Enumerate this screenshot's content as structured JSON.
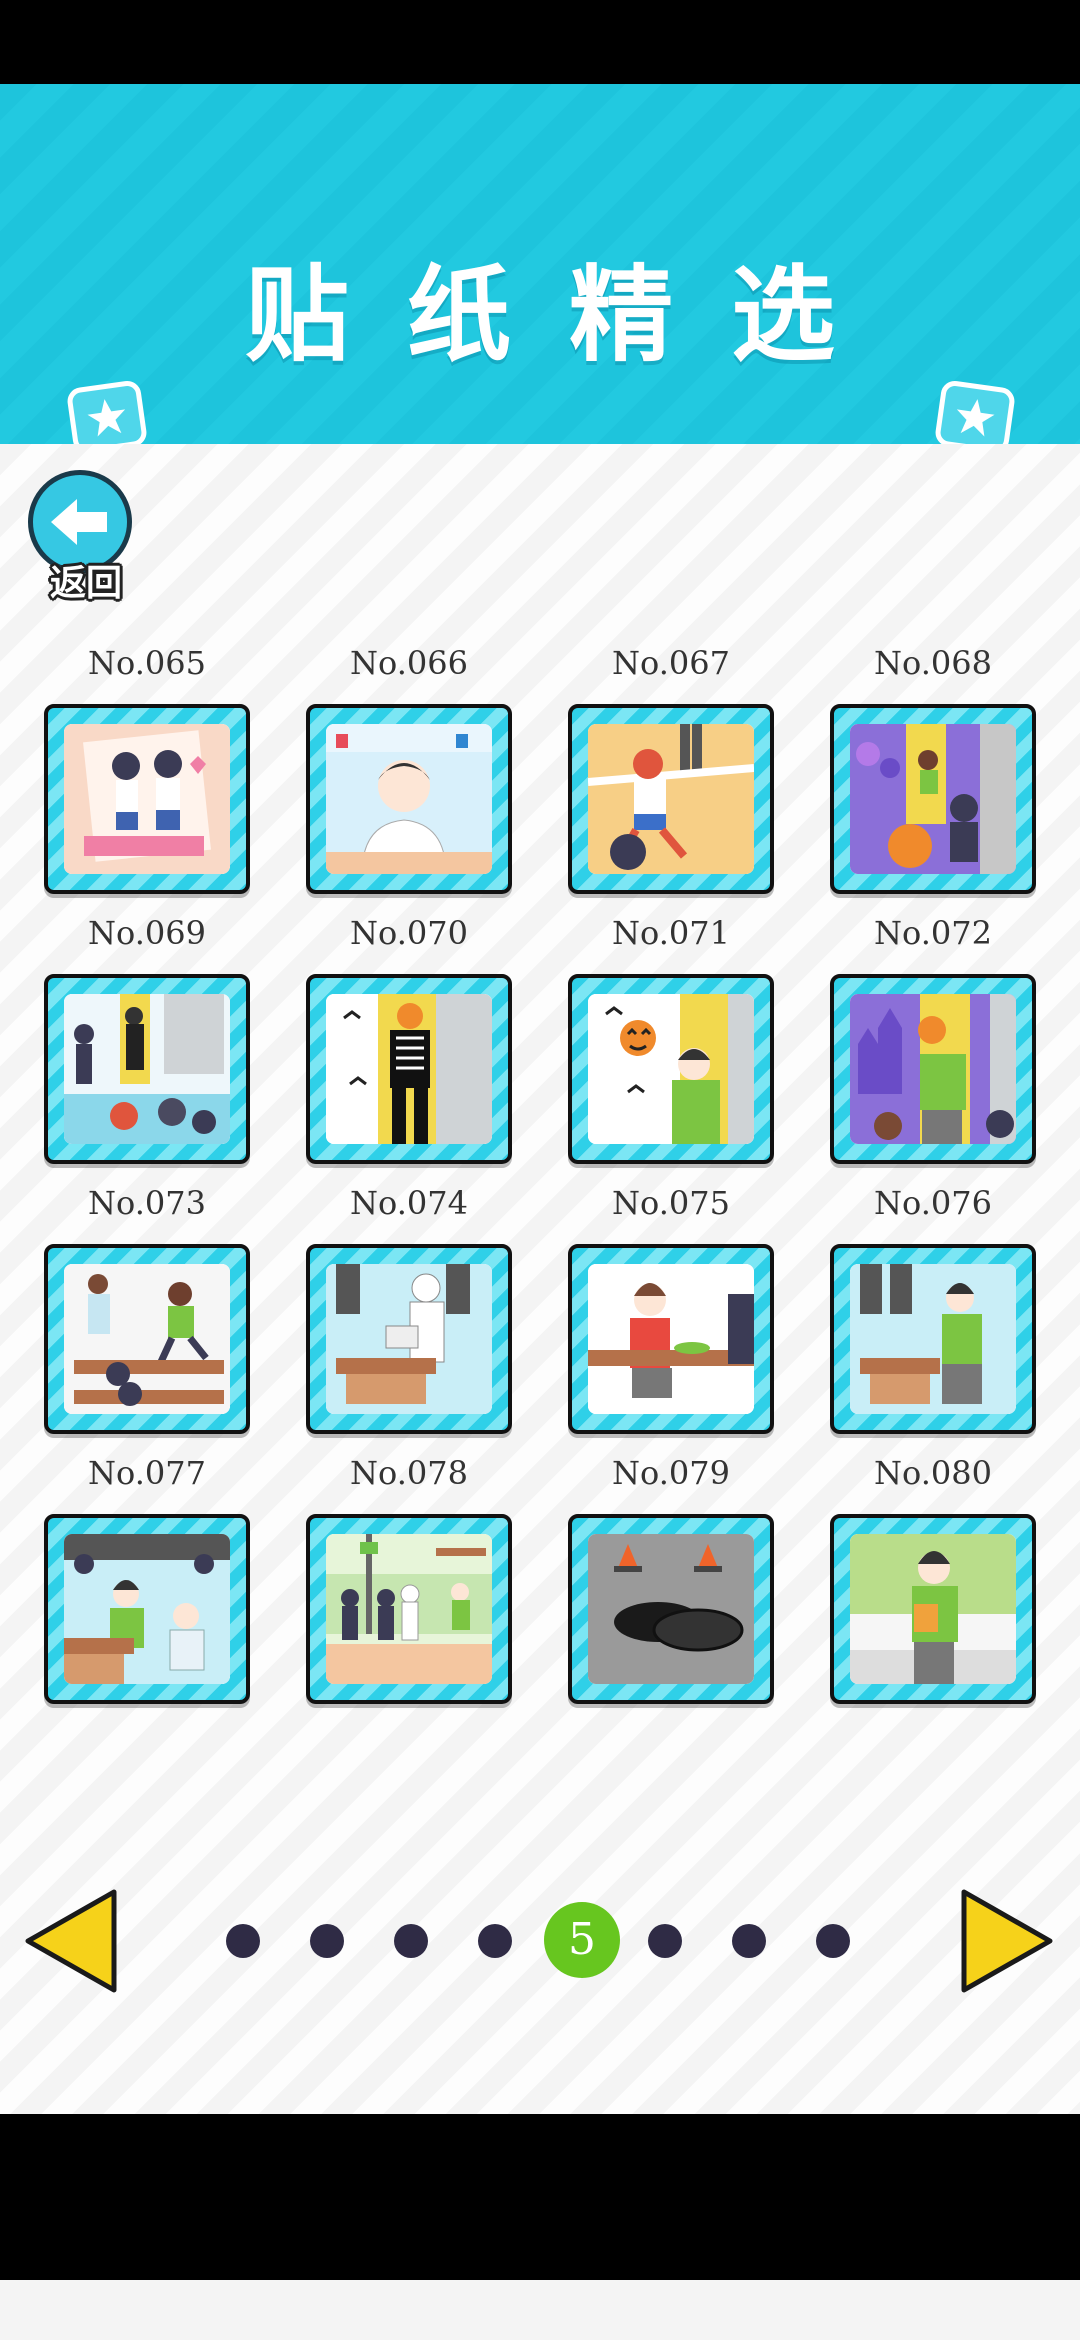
{
  "header": {
    "title": "贴纸精选",
    "back_label": "返回",
    "colors": {
      "header_bg": "#1ec4dc",
      "card_border": "#2fd0e8",
      "active_dot": "#67c61f",
      "arrow": "#f6d21a"
    }
  },
  "stickers": [
    {
      "label": "No.065",
      "icon": "couple-photo-thumb"
    },
    {
      "label": "No.066",
      "icon": "boy-portrait-thumb"
    },
    {
      "label": "No.067",
      "icon": "race-finish-thumb"
    },
    {
      "label": "No.068",
      "icon": "halloween-party-thumb"
    },
    {
      "label": "No.069",
      "icon": "skeleton-classroom-thumb"
    },
    {
      "label": "No.070",
      "icon": "skeleton-costume-thumb"
    },
    {
      "label": "No.071",
      "icon": "pumpkin-boy-thumb"
    },
    {
      "label": "No.072",
      "icon": "pumpkin-castle-thumb"
    },
    {
      "label": "No.073",
      "icon": "classroom-run-thumb"
    },
    {
      "label": "No.074",
      "icon": "reading-student-thumb"
    },
    {
      "label": "No.075",
      "icon": "lunch-desk-thumb"
    },
    {
      "label": "No.076",
      "icon": "classroom-boy-thumb"
    },
    {
      "label": "No.077",
      "icon": "class-group-thumb"
    },
    {
      "label": "No.078",
      "icon": "bus-stop-thumb"
    },
    {
      "label": "No.079",
      "icon": "manhole-cones-thumb"
    },
    {
      "label": "No.080",
      "icon": "snack-boy-thumb"
    }
  ],
  "pagination": {
    "current_page": "5",
    "total_pages": 8,
    "prev_icon": "left-arrow-icon",
    "next_icon": "right-arrow-icon"
  }
}
